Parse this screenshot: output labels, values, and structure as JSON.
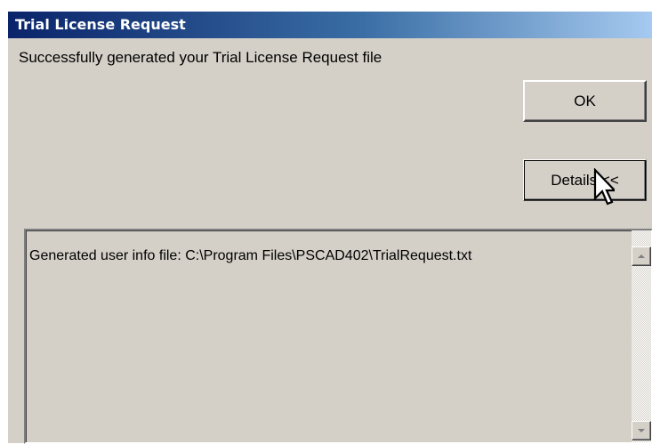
{
  "window": {
    "title": "Trial License Request"
  },
  "message": "Successfully generated your Trial License Request file",
  "buttons": {
    "ok_label": "OK",
    "details_label": "Details <<"
  },
  "details_text": "Generated user info file: C:\\Program Files\\PSCAD402\\TrialRequest.txt",
  "icons": {
    "cursor": "mouse-pointer-icon",
    "scroll_up": "arrow-up-icon",
    "scroll_down": "arrow-down-icon"
  },
  "colors": {
    "dialog_bg": "#d4d0c8",
    "titlebar_start": "#0a246a",
    "titlebar_end": "#a6caf0"
  }
}
